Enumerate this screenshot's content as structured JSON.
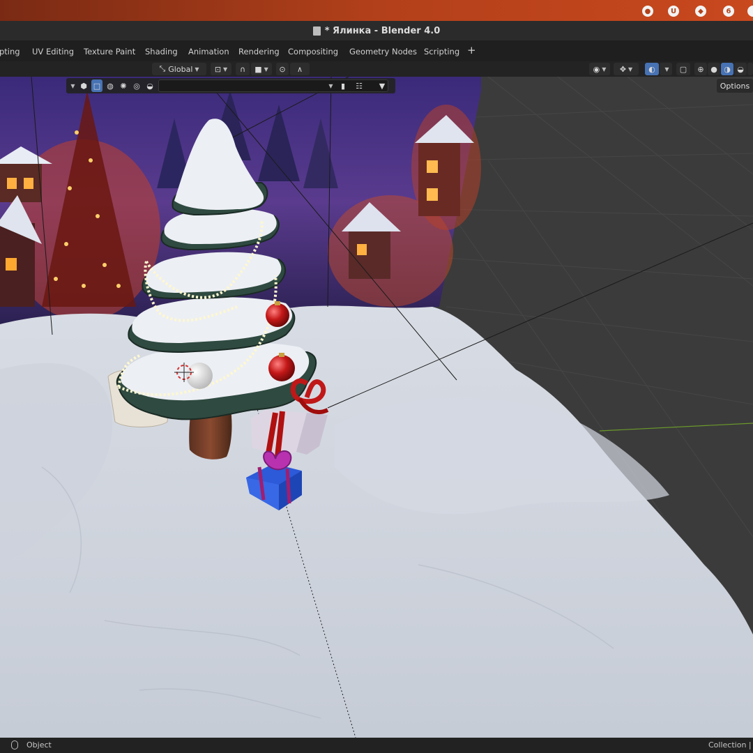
{
  "window": {
    "title": "* Ялинка - Blender 4.0"
  },
  "system_tray": {
    "icons": [
      "record-icon",
      "ubuntu-pro-icon",
      "cube-icon",
      "updates-icon",
      "power-icon"
    ],
    "updates_badge": "6"
  },
  "workspaces": {
    "tabs": [
      {
        "label": "pting"
      },
      {
        "label": "UV Editing"
      },
      {
        "label": "Texture Paint"
      },
      {
        "label": "Shading"
      },
      {
        "label": "Animation"
      },
      {
        "label": "Rendering"
      },
      {
        "label": "Compositing"
      },
      {
        "label": "Geometry Nodes"
      },
      {
        "label": "Scripting"
      }
    ],
    "add_label": "+"
  },
  "viewport_header": {
    "orientation": "Global",
    "options_label": "Options",
    "shading_active": "material-preview"
  },
  "statusbar": {
    "left": "Object",
    "right": "Collection |"
  },
  "colors": {
    "accent": "#4772b3",
    "top_bar": "#c9481e",
    "background": "#1d1d1d"
  }
}
